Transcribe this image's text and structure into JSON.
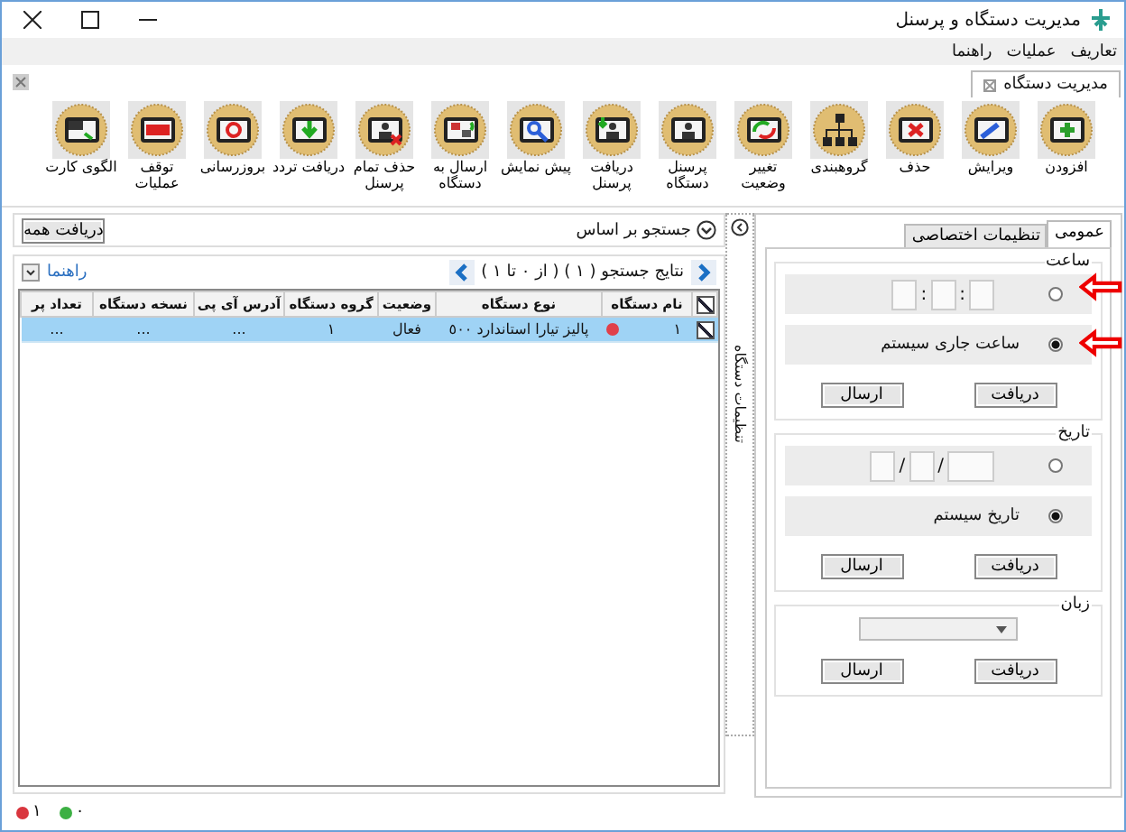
{
  "window": {
    "title": "مدیریت دستگاه و پرسنل"
  },
  "menu": [
    "تعاریف",
    "عملیات",
    "راهنما"
  ],
  "document_tab": {
    "label": "مدیریت دستگاه"
  },
  "toolbar": [
    {
      "kind": "add",
      "label": "افزودن"
    },
    {
      "kind": "edit",
      "label": "ویرایش"
    },
    {
      "kind": "delete",
      "label": "حذف"
    },
    {
      "kind": "group",
      "label": "گروهبندی"
    },
    {
      "kind": "status",
      "label": "تغییر وضعیت"
    },
    {
      "kind": "personnel",
      "label": "پرسنل دستگاه"
    },
    {
      "kind": "receive-personnel",
      "label": "دریافت پرسنل"
    },
    {
      "kind": "preview",
      "label": "پیش نمایش"
    },
    {
      "kind": "send",
      "label": "ارسال به دستگاه"
    },
    {
      "kind": "delete-all",
      "label": "حذف تمام پرسنل"
    },
    {
      "kind": "receive-traffic",
      "label": "دریافت تردد"
    },
    {
      "kind": "refresh",
      "label": "بروزرسانی"
    },
    {
      "kind": "stop",
      "label": "توقف عملیات"
    },
    {
      "kind": "card",
      "label": "الگوی کارت"
    }
  ],
  "search": {
    "label": "جستجو بر اساس",
    "expanded": false,
    "button": "دریافت همه"
  },
  "results": {
    "label": "نتایج جستجو ( ١ ) ( از ٠ تا ١ )",
    "help": "راهنما"
  },
  "table": {
    "header_checked": true,
    "columns": [
      "نام دستگاه",
      "نوع دستگاه",
      "وضعیت",
      "گروه دستگاه",
      "آدرس آی پی",
      "نسخه دستگاه",
      "تعداد پر"
    ],
    "rows": [
      {
        "selected": true,
        "checked": true,
        "connected": false,
        "cells": [
          "١",
          "پالیز تیارا استاندارد ٥٠٠",
          "فعال",
          "١",
          "...",
          "...",
          "..."
        ]
      }
    ]
  },
  "status_bar": [
    {
      "color": "#3cb043",
      "count": "٠"
    },
    {
      "color": "#d9363e",
      "count": "١"
    }
  ],
  "settings": {
    "tabs": [
      {
        "label": "عمومی",
        "selected": true
      },
      {
        "label": "تنظیمات اختصاصی",
        "selected": false
      }
    ],
    "side_tab": "تنظیمات دستگاه",
    "time": {
      "label": "ساعت",
      "options": [
        {
          "kind": "manual",
          "selected": false,
          "separator": ":"
        },
        {
          "kind": "system",
          "selected": true,
          "label": "ساعت جاری سیستم"
        }
      ],
      "buttons": [
        "دریافت",
        "ارسال"
      ]
    },
    "date": {
      "label": "تاریخ",
      "options": [
        {
          "kind": "manual",
          "selected": false,
          "separator": "/"
        },
        {
          "kind": "system",
          "selected": true,
          "label": "تاریخ سیستم"
        }
      ],
      "buttons": [
        "دریافت",
        "ارسال"
      ]
    },
    "language": {
      "label": "زبان",
      "buttons": [
        "دریافت",
        "ارسال"
      ]
    }
  }
}
